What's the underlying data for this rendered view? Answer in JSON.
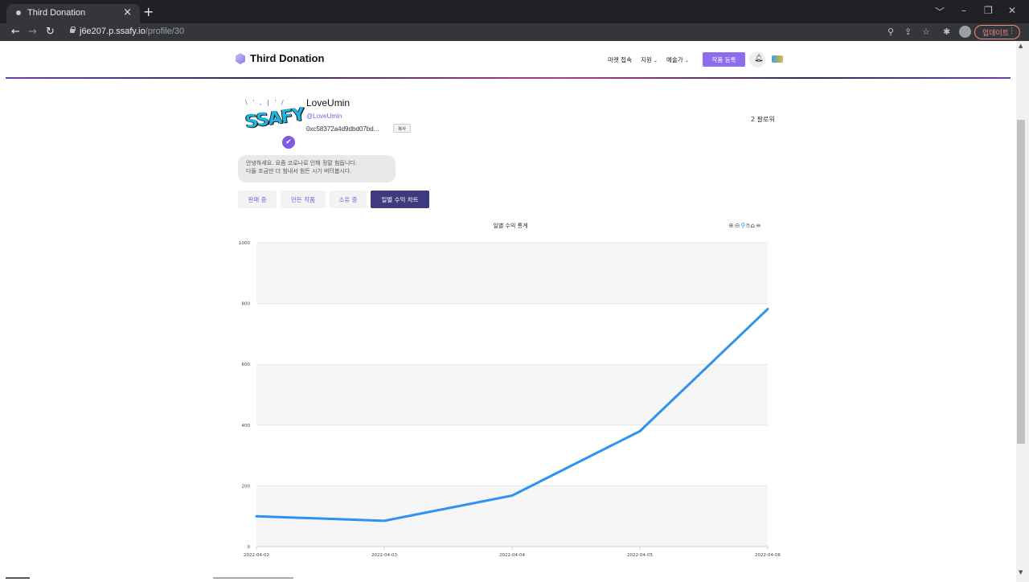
{
  "browser": {
    "tab_title": "Third Donation",
    "tab_close": "×",
    "new_tab": "+",
    "url_host": "j6e207.p.ssafy.io",
    "url_path": "/profile/30",
    "update_label": "업데이트",
    "window_controls": [
      "﹀",
      "–",
      "❐",
      "✕"
    ]
  },
  "header": {
    "logo": "Third Donation",
    "nav_market": "마켓 접속",
    "nav_support": "지원",
    "nav_artist": "예술가",
    "register_button": "작품 등록"
  },
  "profile": {
    "username": "LoveUmin",
    "handle": "@LoveUmin",
    "wallet": "0xc58372a4d9dbd07bd...",
    "copy_label": "복사",
    "followers": "2 팔로워",
    "bio_line1": "안녕하세요. 요즘 코로나로 인해 정말 힘듭니다.",
    "bio_line2": "다들 조금만 더 힘내서 힘든 시기 버텨봅시다.",
    "tabs": [
      {
        "label": "판매 중",
        "active": false
      },
      {
        "label": "만든 작품",
        "active": false
      },
      {
        "label": "소유 중",
        "active": false
      },
      {
        "label": "일별 수익 차트",
        "active": true
      }
    ]
  },
  "chart_data": {
    "type": "line",
    "title": "일별 수익 통계",
    "categories": [
      "2022-04-02",
      "2022-04-03",
      "2022-04-04",
      "2022-04-05",
      "2022-04-06"
    ],
    "series": [
      {
        "values": [
          100,
          85,
          168,
          380,
          782
        ],
        "color": "#2e93f0"
      }
    ],
    "yticks": [
      0,
      200,
      400,
      600,
      800,
      1000
    ],
    "ylim": [
      0,
      1000
    ],
    "grid": true,
    "toolbar_icons": [
      "zoom-in-icon",
      "zoom-out-icon",
      "zoom-select-icon",
      "pan-icon",
      "home-icon",
      "menu-icon"
    ]
  }
}
